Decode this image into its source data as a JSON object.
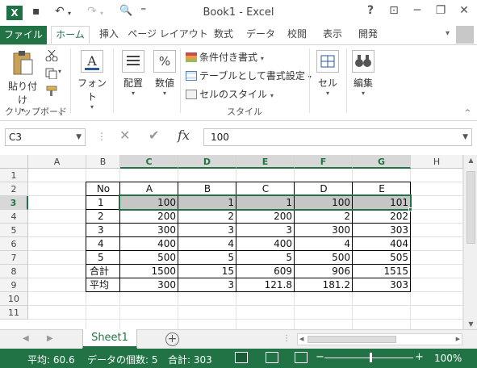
{
  "app": {
    "title": "Book1 - Excel",
    "logo_letter": "X"
  },
  "qat": {
    "undo": "↶",
    "redo": "↷",
    "preview": "🔍",
    "more": "⁼"
  },
  "window_buttons": {
    "help": "?",
    "ribbon_display": "⊡",
    "minimize": "─",
    "restore": "❐",
    "close": "✕"
  },
  "tabs": {
    "file": "ファイル",
    "items": [
      "ホーム",
      "挿入",
      "ページ レイアウト",
      "数式",
      "データ",
      "校閲",
      "表示",
      "開発"
    ]
  },
  "ribbon": {
    "clipboard": {
      "paste": "貼り付け",
      "group": "クリップボード"
    },
    "font": {
      "label": "フォント"
    },
    "alignment": {
      "label": "配置"
    },
    "number": {
      "label": "数値",
      "symbol": "%"
    },
    "styles": {
      "conditional": "条件付き書式",
      "table": "テーブルとして書式設定",
      "cell_styles": "セルのスタイル",
      "group": "スタイル"
    },
    "cells": {
      "label": "セル"
    },
    "editing": {
      "label": "編集"
    }
  },
  "formula_bar": {
    "name_box": "C3",
    "formula": "100",
    "fx": "fx"
  },
  "sheet": {
    "columns": [
      "A",
      "B",
      "C",
      "D",
      "E",
      "F",
      "G",
      "H"
    ],
    "selected_columns": [
      "C",
      "D",
      "E",
      "F",
      "G"
    ],
    "rows": [
      "1",
      "2",
      "3",
      "4",
      "5",
      "6",
      "7",
      "8",
      "9",
      "10",
      "11"
    ],
    "selected_row": "3",
    "table_header": [
      "No",
      "A",
      "B",
      "C",
      "D",
      "E"
    ],
    "table_rows": [
      [
        "1",
        "100",
        "1",
        "1",
        "100",
        "101"
      ],
      [
        "2",
        "200",
        "2",
        "200",
        "2",
        "202"
      ],
      [
        "3",
        "300",
        "3",
        "3",
        "300",
        "303"
      ],
      [
        "4",
        "400",
        "4",
        "400",
        "4",
        "404"
      ],
      [
        "5",
        "500",
        "5",
        "5",
        "500",
        "505"
      ],
      [
        "合計",
        "1500",
        "15",
        "609",
        "906",
        "1515"
      ],
      [
        "平均",
        "300",
        "3",
        "121.8",
        "181.2",
        "303"
      ]
    ]
  },
  "sheet_tabs": {
    "active": "Sheet1",
    "add": "+"
  },
  "status_bar": {
    "average": "平均: 60.6",
    "count": "データの個数: 5",
    "sum": "合計: 303",
    "zoom": "100%",
    "zoom_minus": "−",
    "zoom_plus": "+"
  },
  "colors": {
    "accent": "#217346",
    "selection": "#c6c6c6"
  }
}
